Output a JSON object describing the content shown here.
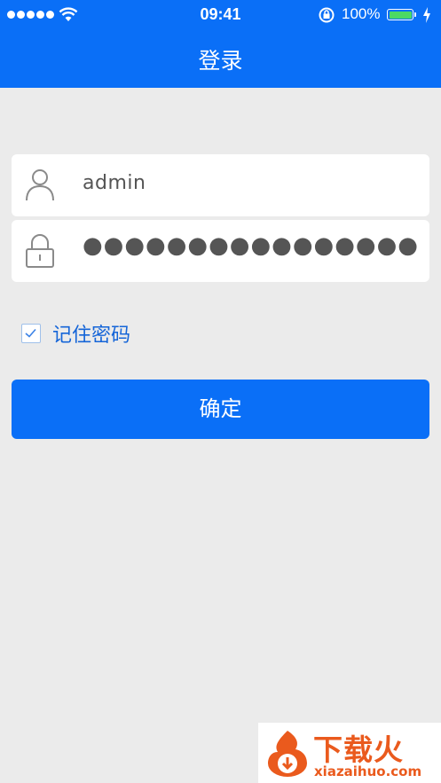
{
  "status_bar": {
    "time": "09:41",
    "battery_percent": "100%",
    "battery_level": 1.0,
    "signal_bars": 5
  },
  "nav": {
    "title": "登录"
  },
  "login": {
    "username_value": "admin",
    "password_value": "●●●●●●●●●●●●●●●●",
    "remember_label": "记住密码",
    "remember_checked": true,
    "submit_label": "确定"
  },
  "watermark": {
    "title": "下载火",
    "url": "xiazaihuo.com"
  },
  "colors": {
    "primary": "#0a6ff7",
    "background": "#ebebeb",
    "battery_fill": "#4cd964",
    "watermark": "#ea5a1d"
  },
  "icons": {
    "user": "user-icon",
    "lock": "lock-icon",
    "check": "check-icon"
  }
}
